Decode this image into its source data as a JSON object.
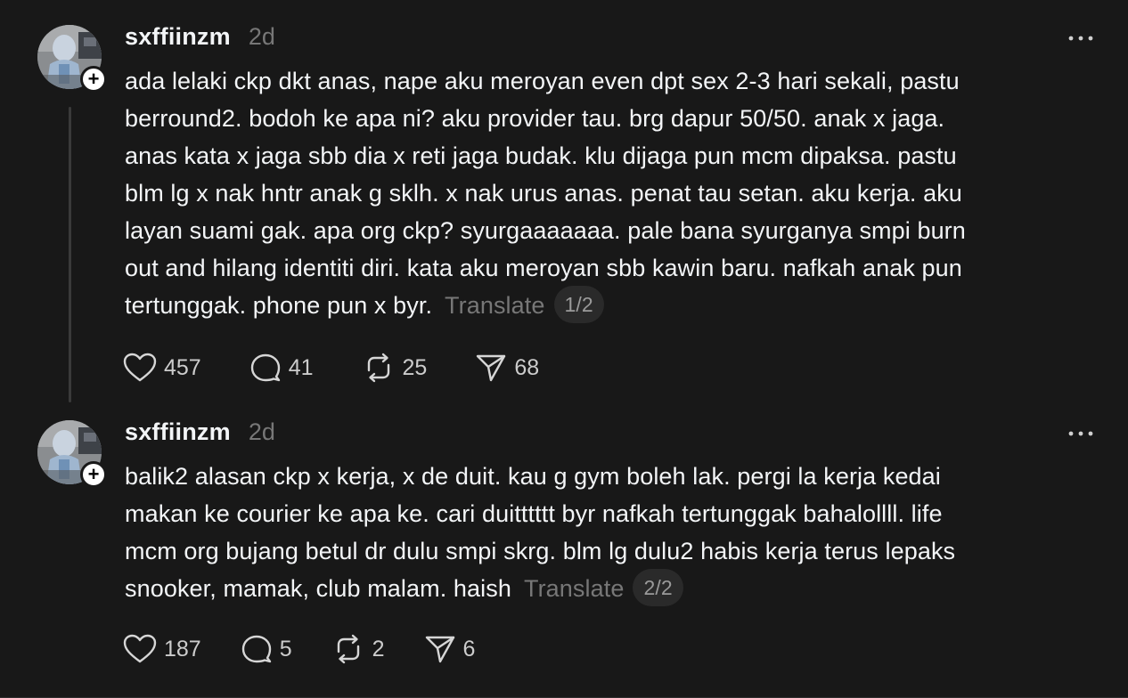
{
  "posts": [
    {
      "username": "sxffiinzm",
      "timestamp": "2d",
      "lines": [
        "ada lelaki ckp dkt anas, nape aku meroyan even dpt sex 2-3 hari sekali, pastu",
        "berround2. bodoh ke apa ni? aku provider tau. brg dapur 50/50. anak x jaga.",
        "anas kata x jaga sbb dia x reti jaga budak. klu dijaga pun mcm dipaksa. pastu",
        "blm lg x nak hntr anak g sklh. x nak urus anas. penat tau setan. aku kerja. aku",
        "layan suami gak. apa org ckp? syurgaaaaaaa. pale bana syurganya smpi burn",
        "out and hilang identiti diri. kata aku meroyan sbb kawin baru. nafkah anak pun",
        "tertunggak. phone pun x byr."
      ],
      "translate_label": "Translate",
      "page_indicator": "1/2",
      "likes": "457",
      "replies": "41",
      "reposts": "25",
      "shares": "68"
    },
    {
      "username": "sxffiinzm",
      "timestamp": "2d",
      "lines": [
        "balik2 alasan ckp x kerja, x de duit. kau g gym boleh lak. pergi la kerja kedai",
        "makan ke courier ke apa ke. cari duitttttt byr nafkah tertunggak bahalollll. life",
        "mcm org bujang betul dr dulu smpi skrg. blm lg dulu2 habis kerja terus lepaks",
        "snooker, mamak, club malam. haish"
      ],
      "translate_label": "Translate",
      "page_indicator": "2/2",
      "likes": "187",
      "replies": "5",
      "reposts": "2",
      "shares": "6"
    }
  ],
  "icons": {
    "like": "heart-icon",
    "reply": "speech-bubble-icon",
    "repost": "repost-arrows-icon",
    "share": "paper-plane-icon",
    "more": "more-dots-icon",
    "follow": "plus-icon"
  },
  "colors": {
    "background": "#181818",
    "text": "#f3f5f7",
    "muted": "#777777"
  }
}
